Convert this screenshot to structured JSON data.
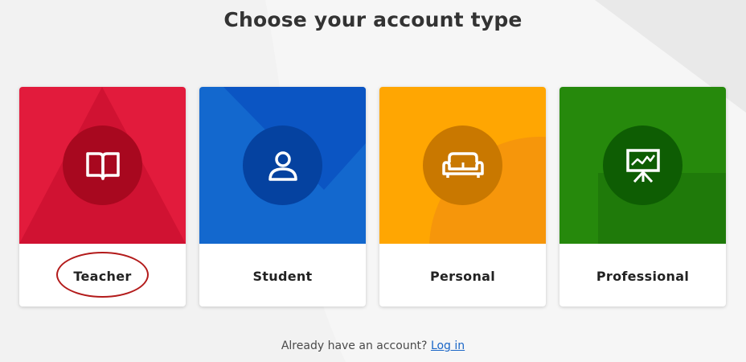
{
  "page": {
    "title": "Choose your account type"
  },
  "cards": [
    {
      "label": "Teacher",
      "icon": "book-icon",
      "color": "#e21b3c",
      "accent": "#a8081f"
    },
    {
      "label": "Student",
      "icon": "user-icon",
      "color": "#1368ce",
      "accent": "#0542a0"
    },
    {
      "label": "Personal",
      "icon": "sofa-icon",
      "color": "#ffa602",
      "accent": "#c97800"
    },
    {
      "label": "Professional",
      "icon": "presentation-icon",
      "color": "#26890c",
      "accent": "#0e5d03"
    }
  ],
  "footer": {
    "text": "Already have an account?",
    "link": "Log in"
  },
  "annotation": {
    "highlight": "Teacher"
  }
}
